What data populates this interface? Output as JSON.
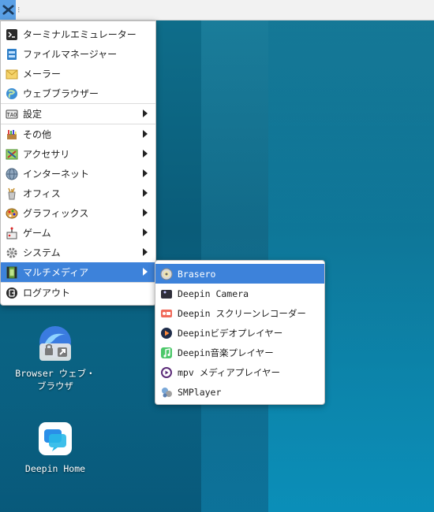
{
  "panel": {
    "separator": "⁝"
  },
  "main_menu": {
    "items": [
      {
        "label": "ターミナルエミュレーター",
        "icon": "terminal-icon"
      },
      {
        "label": "ファイルマネージャー",
        "icon": "file-manager-icon"
      },
      {
        "label": "メーラー",
        "icon": "mail-icon"
      },
      {
        "label": "ウェブブラウザー",
        "icon": "web-browser-icon"
      },
      {
        "label": "設定",
        "icon": "settings-icon",
        "submenu": true
      },
      {
        "label": "その他",
        "icon": "other-icon",
        "submenu": true
      },
      {
        "label": "アクセサリ",
        "icon": "accessories-icon",
        "submenu": true
      },
      {
        "label": "インターネット",
        "icon": "internet-icon",
        "submenu": true
      },
      {
        "label": "オフィス",
        "icon": "office-icon",
        "submenu": true
      },
      {
        "label": "グラフィックス",
        "icon": "graphics-icon",
        "submenu": true
      },
      {
        "label": "ゲーム",
        "icon": "games-icon",
        "submenu": true
      },
      {
        "label": "システム",
        "icon": "system-icon",
        "submenu": true
      },
      {
        "label": "マルチメディア",
        "icon": "multimedia-icon",
        "submenu": true,
        "active": true
      },
      {
        "label": "ログアウト",
        "icon": "logout-icon"
      }
    ]
  },
  "sub_menu": {
    "items": [
      {
        "label": "Brasero",
        "icon": "brasero-icon",
        "active": true
      },
      {
        "label": "Deepin Camera",
        "icon": "camera-icon"
      },
      {
        "label": "Deepin スクリーンレコーダー",
        "icon": "screen-recorder-icon"
      },
      {
        "label": "Deepinビデオプレイヤー",
        "icon": "video-player-icon"
      },
      {
        "label": "Deepin音楽プレイヤー",
        "icon": "music-player-icon"
      },
      {
        "label": "mpv メディアプレイヤー",
        "icon": "mpv-icon"
      },
      {
        "label": "SMPlayer",
        "icon": "smplayer-icon"
      }
    ]
  },
  "desktop": {
    "browser_label": "Browser ウェブ・ブラウザ",
    "home_label": "Deepin Home"
  },
  "colors": {
    "accent": "#3d82da",
    "panel": "#f2f2f2"
  }
}
